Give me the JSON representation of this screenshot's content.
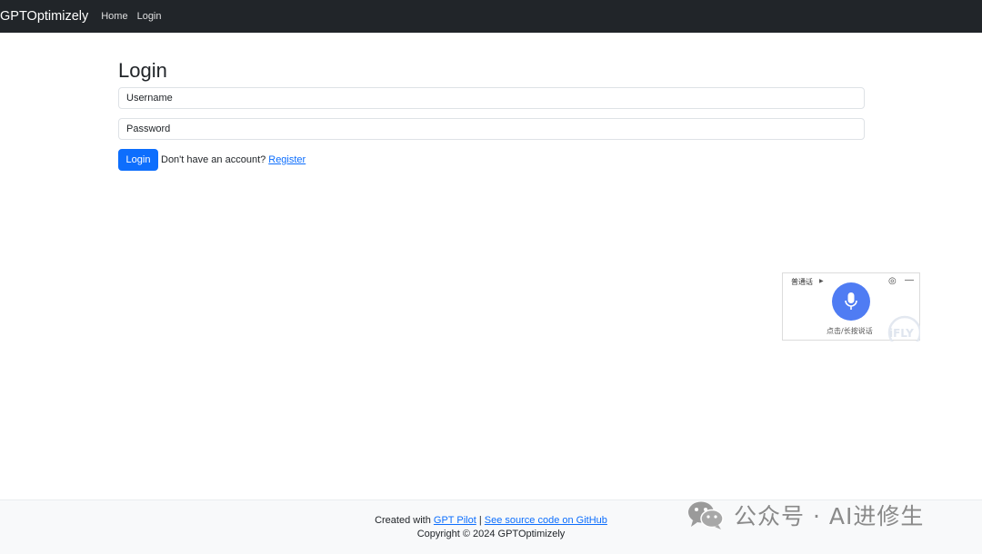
{
  "navbar": {
    "brand": "GPTOptimizely",
    "links": [
      "Home",
      "Login"
    ]
  },
  "login": {
    "title": "Login",
    "username_placeholder": "Username",
    "password_placeholder": "Password",
    "submit_label": "Login",
    "account_text": "Don't have an account?",
    "register_label": "Register"
  },
  "voice_widget": {
    "language": "普通话",
    "hint": "点击/长按说话",
    "logo_text": "iFLY"
  },
  "footer": {
    "created_with": "Created with",
    "gpt_pilot_link": "GPT Pilot",
    "separator": "|",
    "source_link": "See source code on GitHub",
    "copyright": "Copyright © 2024 GPTOptimizely"
  },
  "watermark": {
    "text": "公众号 · AI进修生"
  },
  "colors": {
    "navbar_bg": "#212529",
    "primary": "#0d6efd",
    "footer_bg": "#f8f9fa",
    "mic_button": "#4f7cf3"
  }
}
